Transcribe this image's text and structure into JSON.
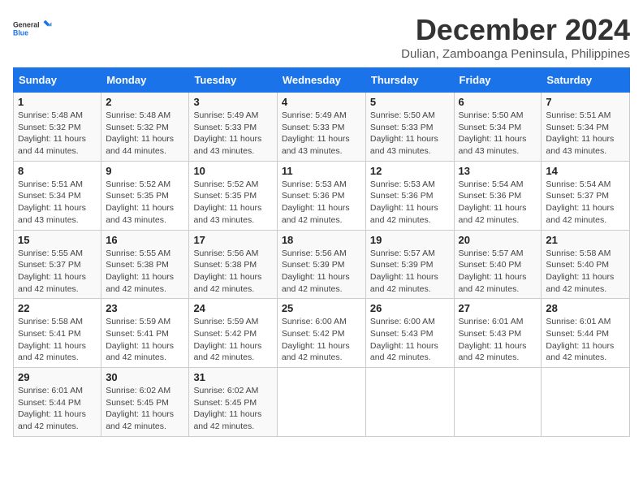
{
  "logo": {
    "line1": "General",
    "line2": "Blue"
  },
  "title": "December 2024",
  "subtitle": "Dulian, Zamboanga Peninsula, Philippines",
  "headers": [
    "Sunday",
    "Monday",
    "Tuesday",
    "Wednesday",
    "Thursday",
    "Friday",
    "Saturday"
  ],
  "weeks": [
    [
      {
        "day": "1",
        "sunrise": "5:48 AM",
        "sunset": "5:32 PM",
        "daylight": "11 hours and 44 minutes."
      },
      {
        "day": "2",
        "sunrise": "5:48 AM",
        "sunset": "5:32 PM",
        "daylight": "11 hours and 44 minutes."
      },
      {
        "day": "3",
        "sunrise": "5:49 AM",
        "sunset": "5:33 PM",
        "daylight": "11 hours and 43 minutes."
      },
      {
        "day": "4",
        "sunrise": "5:49 AM",
        "sunset": "5:33 PM",
        "daylight": "11 hours and 43 minutes."
      },
      {
        "day": "5",
        "sunrise": "5:50 AM",
        "sunset": "5:33 PM",
        "daylight": "11 hours and 43 minutes."
      },
      {
        "day": "6",
        "sunrise": "5:50 AM",
        "sunset": "5:34 PM",
        "daylight": "11 hours and 43 minutes."
      },
      {
        "day": "7",
        "sunrise": "5:51 AM",
        "sunset": "5:34 PM",
        "daylight": "11 hours and 43 minutes."
      }
    ],
    [
      {
        "day": "8",
        "sunrise": "5:51 AM",
        "sunset": "5:34 PM",
        "daylight": "11 hours and 43 minutes."
      },
      {
        "day": "9",
        "sunrise": "5:52 AM",
        "sunset": "5:35 PM",
        "daylight": "11 hours and 43 minutes."
      },
      {
        "day": "10",
        "sunrise": "5:52 AM",
        "sunset": "5:35 PM",
        "daylight": "11 hours and 43 minutes."
      },
      {
        "day": "11",
        "sunrise": "5:53 AM",
        "sunset": "5:36 PM",
        "daylight": "11 hours and 42 minutes."
      },
      {
        "day": "12",
        "sunrise": "5:53 AM",
        "sunset": "5:36 PM",
        "daylight": "11 hours and 42 minutes."
      },
      {
        "day": "13",
        "sunrise": "5:54 AM",
        "sunset": "5:36 PM",
        "daylight": "11 hours and 42 minutes."
      },
      {
        "day": "14",
        "sunrise": "5:54 AM",
        "sunset": "5:37 PM",
        "daylight": "11 hours and 42 minutes."
      }
    ],
    [
      {
        "day": "15",
        "sunrise": "5:55 AM",
        "sunset": "5:37 PM",
        "daylight": "11 hours and 42 minutes."
      },
      {
        "day": "16",
        "sunrise": "5:55 AM",
        "sunset": "5:38 PM",
        "daylight": "11 hours and 42 minutes."
      },
      {
        "day": "17",
        "sunrise": "5:56 AM",
        "sunset": "5:38 PM",
        "daylight": "11 hours and 42 minutes."
      },
      {
        "day": "18",
        "sunrise": "5:56 AM",
        "sunset": "5:39 PM",
        "daylight": "11 hours and 42 minutes."
      },
      {
        "day": "19",
        "sunrise": "5:57 AM",
        "sunset": "5:39 PM",
        "daylight": "11 hours and 42 minutes."
      },
      {
        "day": "20",
        "sunrise": "5:57 AM",
        "sunset": "5:40 PM",
        "daylight": "11 hours and 42 minutes."
      },
      {
        "day": "21",
        "sunrise": "5:58 AM",
        "sunset": "5:40 PM",
        "daylight": "11 hours and 42 minutes."
      }
    ],
    [
      {
        "day": "22",
        "sunrise": "5:58 AM",
        "sunset": "5:41 PM",
        "daylight": "11 hours and 42 minutes."
      },
      {
        "day": "23",
        "sunrise": "5:59 AM",
        "sunset": "5:41 PM",
        "daylight": "11 hours and 42 minutes."
      },
      {
        "day": "24",
        "sunrise": "5:59 AM",
        "sunset": "5:42 PM",
        "daylight": "11 hours and 42 minutes."
      },
      {
        "day": "25",
        "sunrise": "6:00 AM",
        "sunset": "5:42 PM",
        "daylight": "11 hours and 42 minutes."
      },
      {
        "day": "26",
        "sunrise": "6:00 AM",
        "sunset": "5:43 PM",
        "daylight": "11 hours and 42 minutes."
      },
      {
        "day": "27",
        "sunrise": "6:01 AM",
        "sunset": "5:43 PM",
        "daylight": "11 hours and 42 minutes."
      },
      {
        "day": "28",
        "sunrise": "6:01 AM",
        "sunset": "5:44 PM",
        "daylight": "11 hours and 42 minutes."
      }
    ],
    [
      {
        "day": "29",
        "sunrise": "6:01 AM",
        "sunset": "5:44 PM",
        "daylight": "11 hours and 42 minutes."
      },
      {
        "day": "30",
        "sunrise": "6:02 AM",
        "sunset": "5:45 PM",
        "daylight": "11 hours and 42 minutes."
      },
      {
        "day": "31",
        "sunrise": "6:02 AM",
        "sunset": "5:45 PM",
        "daylight": "11 hours and 42 minutes."
      },
      null,
      null,
      null,
      null
    ]
  ],
  "labels": {
    "sunrise": "Sunrise:",
    "sunset": "Sunset:",
    "daylight": "Daylight:"
  }
}
